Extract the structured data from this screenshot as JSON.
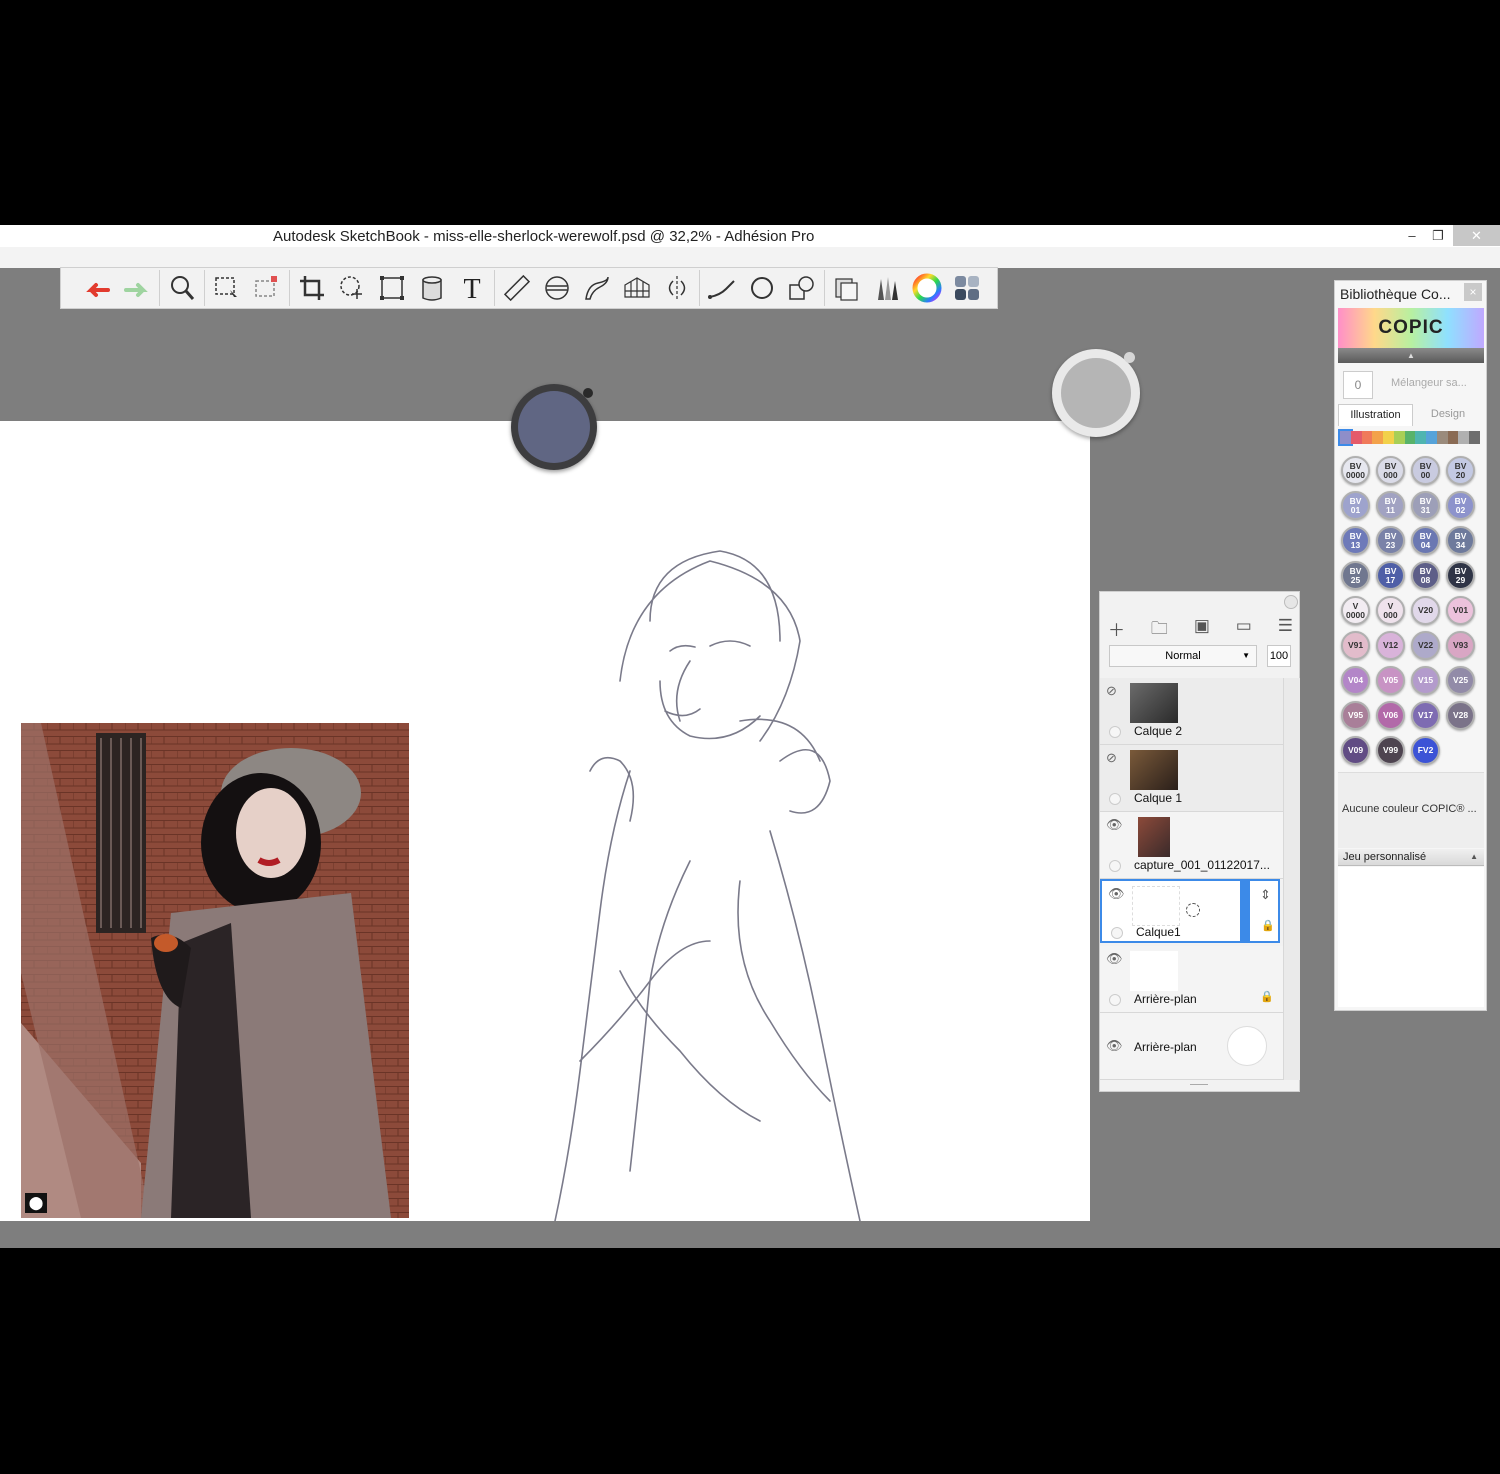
{
  "window": {
    "title": "Autodesk SketchBook - miss-elle-sherlock-werewolf.psd @ 32,2% - Adhésion Pro",
    "minimize": "‒",
    "restore": "❐",
    "close": "✕"
  },
  "toolbar": {
    "tools": [
      "undo-icon",
      "redo-icon",
      "zoom-icon",
      "select-icon",
      "select-add-icon",
      "crop-icon",
      "lasso-transform-icon",
      "distort-icon",
      "fill-bucket-icon",
      "text-icon",
      "ruler-icon",
      "ellipse-guide-icon",
      "french-curve-icon",
      "perspective-icon",
      "symmetry-icon",
      "stroke-icon",
      "circle-icon",
      "shapes-icon",
      "layer-editor-icon",
      "brush-palette-icon",
      "color-wheel-icon",
      "copic-library-icon"
    ]
  },
  "puck": {
    "brush_color": "#606683",
    "secondary_color": "#b5b5b5"
  },
  "layers": {
    "blend_mode": "Normal",
    "opacity": "100",
    "rows": [
      {
        "name": "Calque 2",
        "visible": false
      },
      {
        "name": "Calque 1",
        "visible": false
      },
      {
        "name": "capture_001_01122017...",
        "visible": true
      },
      {
        "name": "Calque1",
        "visible": true,
        "selected": true
      },
      {
        "name": "Arrière-plan",
        "visible": true,
        "locked": true
      },
      {
        "name": "Arrière-plan",
        "visible": true
      }
    ]
  },
  "copic": {
    "title": "Bibliothèque Co...",
    "close": "×",
    "logo": "COPIC",
    "mixer_count": "0",
    "mixer_label": "Mélangeur sa...",
    "tabs": [
      "Illustration",
      "Design"
    ],
    "palette_strip": [
      "#8e8ec9",
      "#e45b6a",
      "#f07a5a",
      "#f3a24b",
      "#f2d14a",
      "#a8cf56",
      "#58b36a",
      "#4fb5b0",
      "#56a3d9",
      "#9a8b7c",
      "#8a6b54",
      "#b0b0b0",
      "#6e6e6e"
    ],
    "swatches": [
      {
        "label": "BV\n0000",
        "color": "#e6e7ef"
      },
      {
        "label": "BV\n000",
        "color": "#dadbe8"
      },
      {
        "label": "BV\n00",
        "color": "#c9cbe0"
      },
      {
        "label": "BV\n20",
        "color": "#c3c9e3"
      },
      {
        "label": "BV\n01",
        "color": "#9ea3cd"
      },
      {
        "label": "BV\n11",
        "color": "#a1a2c2"
      },
      {
        "label": "BV\n31",
        "color": "#9d9fb8"
      },
      {
        "label": "BV\n02",
        "color": "#8d93cc"
      },
      {
        "label": "BV\n13",
        "color": "#6e7ab9"
      },
      {
        "label": "BV\n23",
        "color": "#7a82a8"
      },
      {
        "label": "BV\n04",
        "color": "#6b78b2"
      },
      {
        "label": "BV\n34",
        "color": "#6e7a9c"
      },
      {
        "label": "BV\n25",
        "color": "#70778f"
      },
      {
        "label": "BV\n17",
        "color": "#4f5fa7"
      },
      {
        "label": "BV\n08",
        "color": "#5d5e88"
      },
      {
        "label": "BV\n29",
        "color": "#2f3446"
      },
      {
        "label": "V\n0000",
        "color": "#f2ecf2"
      },
      {
        "label": "V\n000",
        "color": "#efe2ec"
      },
      {
        "label": "V20",
        "color": "#e1d8ea"
      },
      {
        "label": "V01",
        "color": "#ecc2dc"
      },
      {
        "label": "V91",
        "color": "#e2bccb"
      },
      {
        "label": "V12",
        "color": "#d9b3da"
      },
      {
        "label": "V22",
        "color": "#aeaaca"
      },
      {
        "label": "V93",
        "color": "#d9a6c4"
      },
      {
        "label": "V04",
        "color": "#b386c8"
      },
      {
        "label": "V05",
        "color": "#c893c4"
      },
      {
        "label": "V15",
        "color": "#b39bcc"
      },
      {
        "label": "V25",
        "color": "#928ba8"
      },
      {
        "label": "V95",
        "color": "#a97f99"
      },
      {
        "label": "V06",
        "color": "#b269a9"
      },
      {
        "label": "V17",
        "color": "#7e6cb2"
      },
      {
        "label": "V28",
        "color": "#7b7389"
      },
      {
        "label": "V09",
        "color": "#614c84"
      },
      {
        "label": "V99",
        "color": "#4e4450"
      },
      {
        "label": "FV2",
        "color": "#3c53d6"
      }
    ],
    "no_color_label": "Aucune couleur COPIC® ...",
    "custom_set_label": "Jeu personnalisé"
  }
}
